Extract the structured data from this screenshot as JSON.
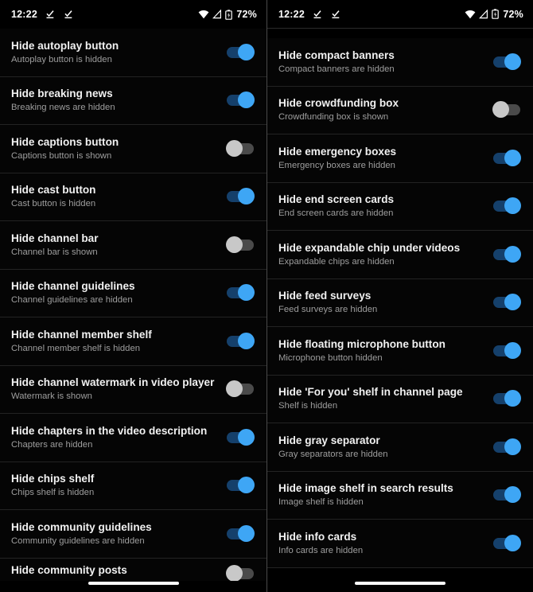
{
  "statusbar": {
    "time": "12:22",
    "battery_percent": "72%",
    "icons": [
      "check-notification-icon",
      "check-notification-icon",
      "wifi-icon",
      "cellular-signal-icon",
      "battery-icon"
    ]
  },
  "colors": {
    "background": "#000000",
    "row_background": "#050505",
    "divider": "#232323",
    "title_text": "#f1f1f1",
    "summary_text": "#9e9e9e",
    "switch_on_track": "#15406b",
    "switch_on_thumb": "#3ea6f5",
    "switch_off_track": "#4a4a4a",
    "switch_off_thumb": "#c8c8c8"
  },
  "left_panel": {
    "rows": [
      {
        "title": "Hide autoplay button",
        "summary": "Autoplay button is hidden",
        "state": "on"
      },
      {
        "title": "Hide breaking news",
        "summary": "Breaking news are hidden",
        "state": "on"
      },
      {
        "title": "Hide captions button",
        "summary": "Captions button is shown",
        "state": "off"
      },
      {
        "title": "Hide cast button",
        "summary": "Cast button is hidden",
        "state": "on"
      },
      {
        "title": "Hide channel bar",
        "summary": "Channel bar is shown",
        "state": "off"
      },
      {
        "title": "Hide channel guidelines",
        "summary": "Channel guidelines are hidden",
        "state": "on"
      },
      {
        "title": "Hide channel member shelf",
        "summary": "Channel member shelf is hidden",
        "state": "on"
      },
      {
        "title": "Hide channel watermark in video player",
        "summary": "Watermark is shown",
        "state": "off"
      },
      {
        "title": "Hide chapters in the video description",
        "summary": "Chapters are hidden",
        "state": "on"
      },
      {
        "title": "Hide chips shelf",
        "summary": "Chips shelf is hidden",
        "state": "on"
      },
      {
        "title": "Hide community guidelines",
        "summary": "Community guidelines are hidden",
        "state": "on"
      },
      {
        "title": "Hide community posts",
        "summary": "",
        "state": "off"
      }
    ]
  },
  "right_panel": {
    "rows": [
      {
        "title": "Hide compact banners",
        "summary": "Compact banners are hidden",
        "state": "on"
      },
      {
        "title": "Hide crowdfunding box",
        "summary": "Crowdfunding box is shown",
        "state": "off"
      },
      {
        "title": "Hide emergency boxes",
        "summary": "Emergency boxes are hidden",
        "state": "on"
      },
      {
        "title": "Hide end screen cards",
        "summary": "End screen cards are hidden",
        "state": "on"
      },
      {
        "title": "Hide expandable chip under videos",
        "summary": "Expandable chips are hidden",
        "state": "on"
      },
      {
        "title": "Hide feed surveys",
        "summary": "Feed surveys are hidden",
        "state": "on"
      },
      {
        "title": "Hide floating microphone button",
        "summary": "Microphone button hidden",
        "state": "on"
      },
      {
        "title": "Hide 'For you' shelf in channel page",
        "summary": "Shelf is hidden",
        "state": "on"
      },
      {
        "title": "Hide gray separator",
        "summary": "Gray separators are hidden",
        "state": "on"
      },
      {
        "title": "Hide image shelf in search results",
        "summary": "Image shelf is hidden",
        "state": "on"
      },
      {
        "title": "Hide info cards",
        "summary": "Info cards are hidden",
        "state": "on"
      }
    ]
  }
}
